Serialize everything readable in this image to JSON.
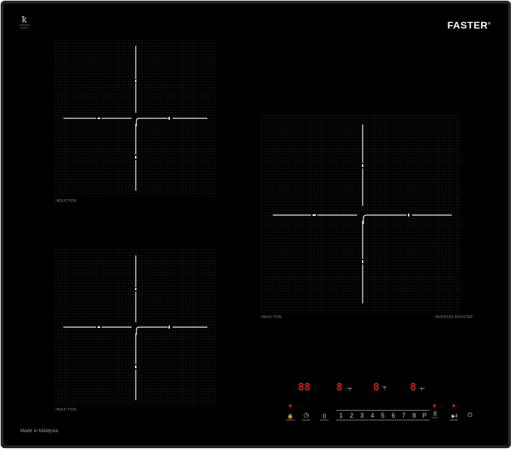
{
  "brand": {
    "name": "FASTER",
    "mark": "®"
  },
  "logo": {
    "symbol": "ꝁ",
    "sub": "PREMIUM DESIGN"
  },
  "zones": {
    "top_left_label": "INDUCTION",
    "bottom_left_label": "INDUCTION",
    "right_label": "INDUCTION",
    "right_sub_label": "INVERTER BOOSTER"
  },
  "footer": {
    "made_in": "Made in Malaysia"
  },
  "displays": {
    "timer": "88",
    "zone_a": "8",
    "zone_b": "8",
    "zone_c": "8"
  },
  "controls": {
    "lock_icon": "🔒",
    "timer_icon": "◷",
    "zero": "0",
    "levels": [
      "1",
      "2",
      "3",
      "4",
      "5",
      "6",
      "7",
      "8",
      "P"
    ],
    "warm_icon": "|||",
    "warm_label": "WARM",
    "pause_icon": "▶‖",
    "power_icon": "⏻"
  },
  "colors": {
    "display": "#e21515",
    "glass": "#000000"
  }
}
